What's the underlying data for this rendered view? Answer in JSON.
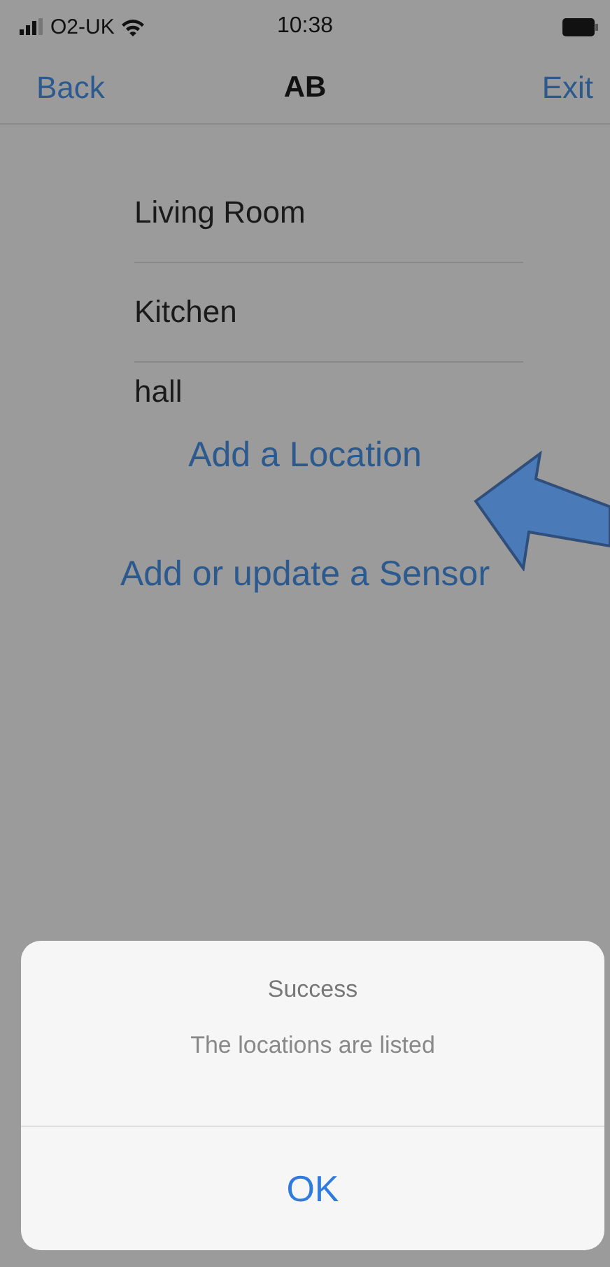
{
  "status_bar": {
    "carrier": "O2-UK",
    "time": "10:38"
  },
  "nav_bar": {
    "back": "Back",
    "title": "AB",
    "exit": "Exit"
  },
  "locations": [
    "Living Room",
    "Kitchen",
    "hall"
  ],
  "links": [
    "Add a Location",
    "Add or update a Sensor"
  ],
  "alert": {
    "title": "Success",
    "message": "The locations are listed",
    "button": "OK"
  }
}
